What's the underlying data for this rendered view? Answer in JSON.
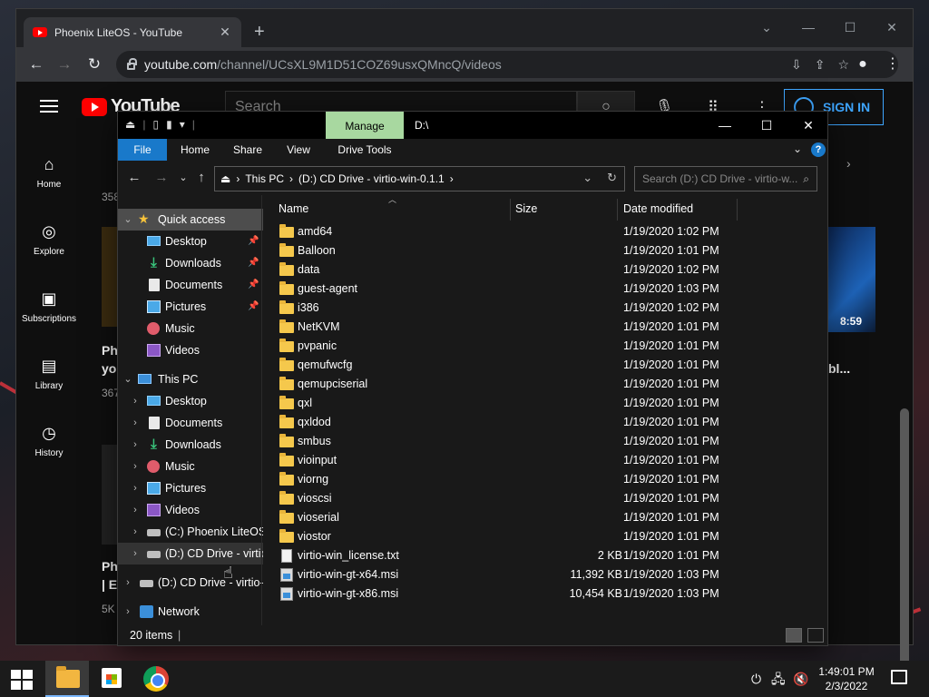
{
  "chrome": {
    "tab_title": "Phoenix LiteOS - YouTube",
    "new_tab": "+",
    "url_host": "youtube.com",
    "url_path": "/channel/UCsXL9M1D51COZ69usxQMncQ/videos"
  },
  "youtube": {
    "logo_text": "YouTube",
    "search_placeholder": "Search",
    "sign_in": "SIGN IN",
    "sidebar": [
      {
        "label": "Home"
      },
      {
        "label": "Explore"
      },
      {
        "label": "Subscriptions"
      },
      {
        "label": "Library"
      },
      {
        "label": "History"
      }
    ],
    "partial": {
      "count_1": "358",
      "title_1a": "Ph",
      "title_1b": "yo",
      "meta_1": "367",
      "title_2a": "Ph",
      "title_2b": "| E",
      "meta_2": "5K",
      "duration": "8:59",
      "title_right": "bl..."
    }
  },
  "explorer": {
    "title_path": "D:\\",
    "manage_tab": "Manage",
    "ribbon_tabs": [
      "File",
      "Home",
      "Share",
      "View",
      "Drive Tools"
    ],
    "help": "?",
    "address": {
      "crumbs": [
        "This PC",
        "(D:) CD Drive - virtio-win-0.1.1"
      ]
    },
    "search_placeholder": "Search (D:) CD Drive - virtio-w...",
    "nav": {
      "quick_access": "Quick access",
      "quick_items": [
        "Desktop",
        "Downloads",
        "Documents",
        "Pictures",
        "Music",
        "Videos"
      ],
      "this_pc": "This PC",
      "pc_items": [
        "Desktop",
        "Documents",
        "Downloads",
        "Music",
        "Pictures",
        "Videos",
        "(C:) Phoenix LiteOS",
        "(D:) CD Drive - virtio"
      ],
      "cd_drive_root": "(D:) CD Drive - virtio-",
      "network": "Network"
    },
    "columns": {
      "name": "Name",
      "size": "Size",
      "date": "Date modified"
    },
    "files": [
      {
        "name": "amd64",
        "type": "folder",
        "size": "",
        "date": "1/19/2020 1:02 PM"
      },
      {
        "name": "Balloon",
        "type": "folder",
        "size": "",
        "date": "1/19/2020 1:01 PM"
      },
      {
        "name": "data",
        "type": "folder",
        "size": "",
        "date": "1/19/2020 1:02 PM"
      },
      {
        "name": "guest-agent",
        "type": "folder",
        "size": "",
        "date": "1/19/2020 1:03 PM"
      },
      {
        "name": "i386",
        "type": "folder",
        "size": "",
        "date": "1/19/2020 1:02 PM"
      },
      {
        "name": "NetKVM",
        "type": "folder",
        "size": "",
        "date": "1/19/2020 1:01 PM"
      },
      {
        "name": "pvpanic",
        "type": "folder",
        "size": "",
        "date": "1/19/2020 1:01 PM"
      },
      {
        "name": "qemufwcfg",
        "type": "folder",
        "size": "",
        "date": "1/19/2020 1:01 PM"
      },
      {
        "name": "qemupciserial",
        "type": "folder",
        "size": "",
        "date": "1/19/2020 1:01 PM"
      },
      {
        "name": "qxl",
        "type": "folder",
        "size": "",
        "date": "1/19/2020 1:01 PM"
      },
      {
        "name": "qxldod",
        "type": "folder",
        "size": "",
        "date": "1/19/2020 1:01 PM"
      },
      {
        "name": "smbus",
        "type": "folder",
        "size": "",
        "date": "1/19/2020 1:01 PM"
      },
      {
        "name": "vioinput",
        "type": "folder",
        "size": "",
        "date": "1/19/2020 1:01 PM"
      },
      {
        "name": "viorng",
        "type": "folder",
        "size": "",
        "date": "1/19/2020 1:01 PM"
      },
      {
        "name": "vioscsi",
        "type": "folder",
        "size": "",
        "date": "1/19/2020 1:01 PM"
      },
      {
        "name": "vioserial",
        "type": "folder",
        "size": "",
        "date": "1/19/2020 1:01 PM"
      },
      {
        "name": "viostor",
        "type": "folder",
        "size": "",
        "date": "1/19/2020 1:01 PM"
      },
      {
        "name": "virtio-win_license.txt",
        "type": "txt",
        "size": "2 KB",
        "date": "1/19/2020 1:01 PM"
      },
      {
        "name": "virtio-win-gt-x64.msi",
        "type": "msi",
        "size": "11,392 KB",
        "date": "1/19/2020 1:03 PM"
      },
      {
        "name": "virtio-win-gt-x86.msi",
        "type": "msi",
        "size": "10,454 KB",
        "date": "1/19/2020 1:03 PM"
      }
    ],
    "status": "20 items"
  },
  "taskbar": {
    "time": "1:49:01 PM",
    "date": "2/3/2022"
  },
  "colors": {
    "accent_blue": "#1979ca",
    "manage_green": "#a8d8a0",
    "youtube_red": "#ff0000",
    "signin_blue": "#3ea6ff",
    "folder_yellow": "#f5c84c"
  }
}
